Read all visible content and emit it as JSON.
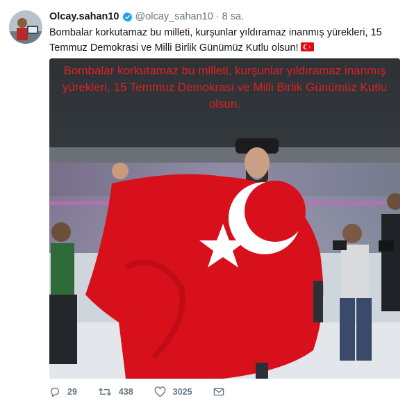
{
  "tweet": {
    "display_name": "Olcay.sahan10",
    "handle": "@olcay_sahan10",
    "separator": "·",
    "time": "8 sa.",
    "text": "Bombalar korkutamaz bu milleti, kurşunlar yıldıramaz inanmış yürekleri, 15 Temmuz Demokrasi ve Milli Birlik Günümüz Kutlu olsun!",
    "image_caption": "Bombalar korkutamaz bu milleti, kurşunlar yıldıramaz inanmış yürekleri, 15 Temmuz Demokrasi ve Milli Birlik Günümüz Kutlu olsun."
  },
  "actions": {
    "reply_count": "29",
    "retweet_count": "438",
    "like_count": "3025"
  },
  "colors": {
    "verified_blue": "#1da1f2",
    "meta_gray": "#657786",
    "flag_red": "#e30a17",
    "caption_red": "#e02020"
  },
  "icons": [
    "verified-badge-icon",
    "turkey-flag-icon",
    "reply-icon",
    "retweet-icon",
    "like-icon",
    "direct-message-icon"
  ]
}
